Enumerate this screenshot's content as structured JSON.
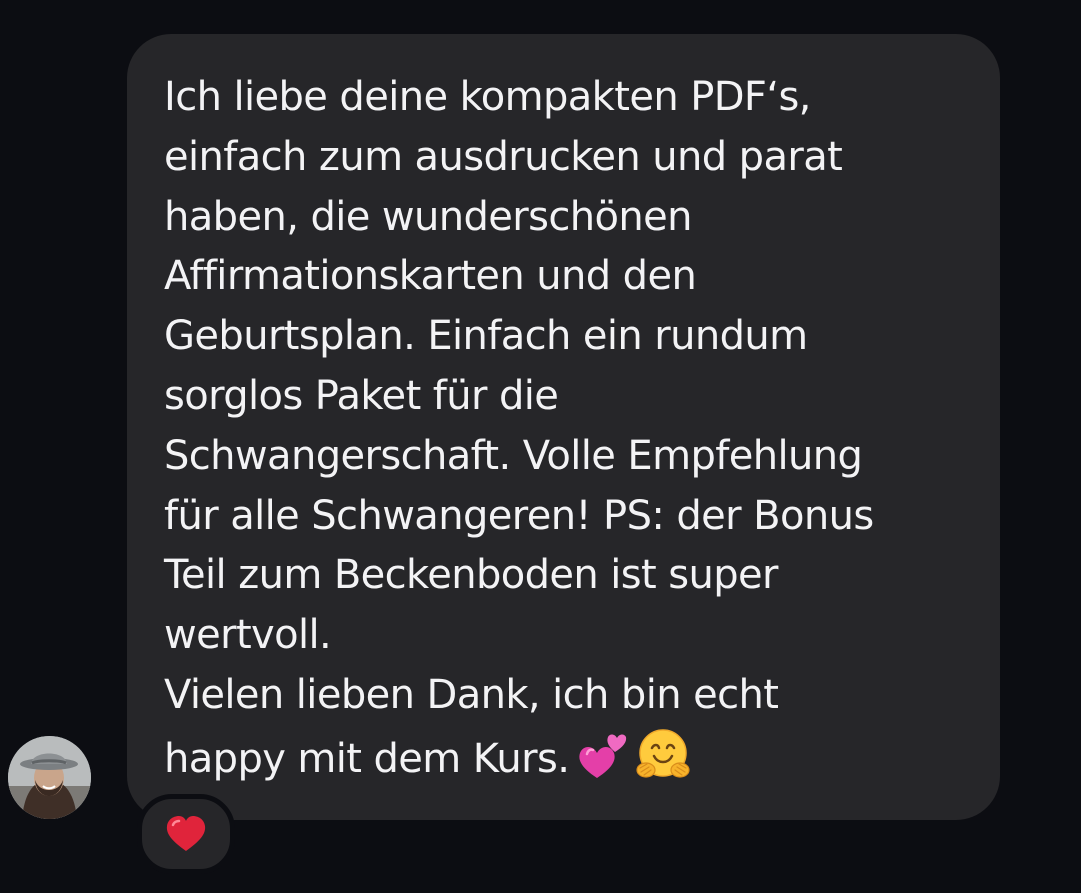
{
  "message": {
    "lines_paragraph_1": [
      "Ich liebe deine kompakten PDF‘s,",
      "einfach zum ausdrucken und parat",
      "haben, die wunderschönen",
      "Affirmationskarten und den",
      "Geburtsplan. Einfach ein rundum",
      "sorglos Paket für die",
      "Schwangerschaft. Volle Empfehlung",
      "für alle Schwangeren! PS: der Bonus",
      "Teil zum Beckenboden ist super",
      "wertvoll."
    ],
    "lines_paragraph_2": [
      "Vielen lieben Dank, ich bin echt",
      "happy mit dem Kurs."
    ],
    "trailing_emojis": [
      "two-hearts-emoji",
      "hugging-face-emoji"
    ]
  },
  "reaction": {
    "icon": "red-heart-icon"
  },
  "avatar": {
    "icon": "user-avatar"
  },
  "colors": {
    "background": "#0c0d12",
    "bubble": "#262629",
    "text": "#f3f3f5",
    "heart": "#e0243b"
  }
}
